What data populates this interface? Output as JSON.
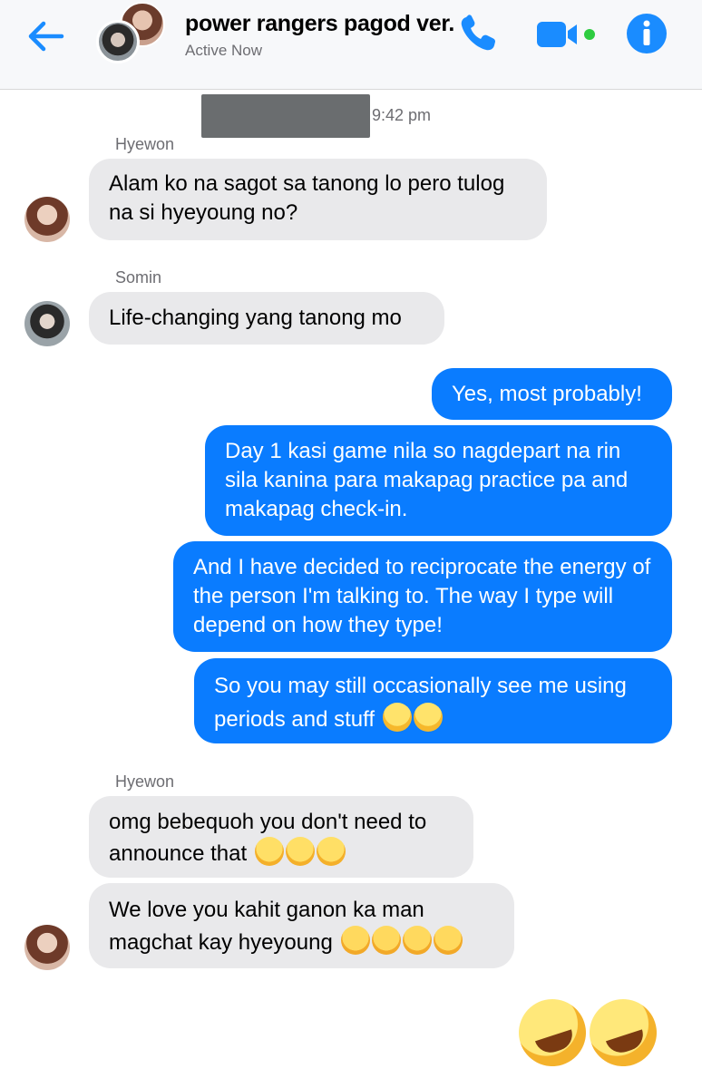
{
  "header": {
    "title": "power rangers pagod ver.",
    "status": "Active Now",
    "icons": {
      "back": "back-arrow-icon",
      "call": "phone-icon",
      "video": "video-camera-icon",
      "info": "info-icon"
    }
  },
  "messages": {
    "timestamp": "9:42 pm",
    "sender_1": "Hyewon",
    "msg_1": "Alam ko na sagot sa tanong lo pero tulog na si hyeyoung no?",
    "sender_2": "Somin",
    "msg_2": "Life-changing yang tanong mo",
    "out_1": "Yes, most probably!",
    "out_2": "Day 1 kasi game nila so nagdepart na rin sila kanina para makapag practice pa and makapag check-in.",
    "out_3": "And I have decided to reciprocate the energy of the person I'm talking to. The way I type will depend on how they type!",
    "out_4": "So you may still occasionally see me using periods and stuff",
    "sender_3": "Hyewon",
    "msg_3": "omg bebequoh you don't need to announce that",
    "msg_4": "We love you kahit ganon ka man magchat kay hyeyoung"
  },
  "colors": {
    "accent": "#0a7cff",
    "incoming_bubble": "#e9e9eb",
    "header_bg": "#f7f8fa",
    "secondary_text": "#6d6d72"
  }
}
